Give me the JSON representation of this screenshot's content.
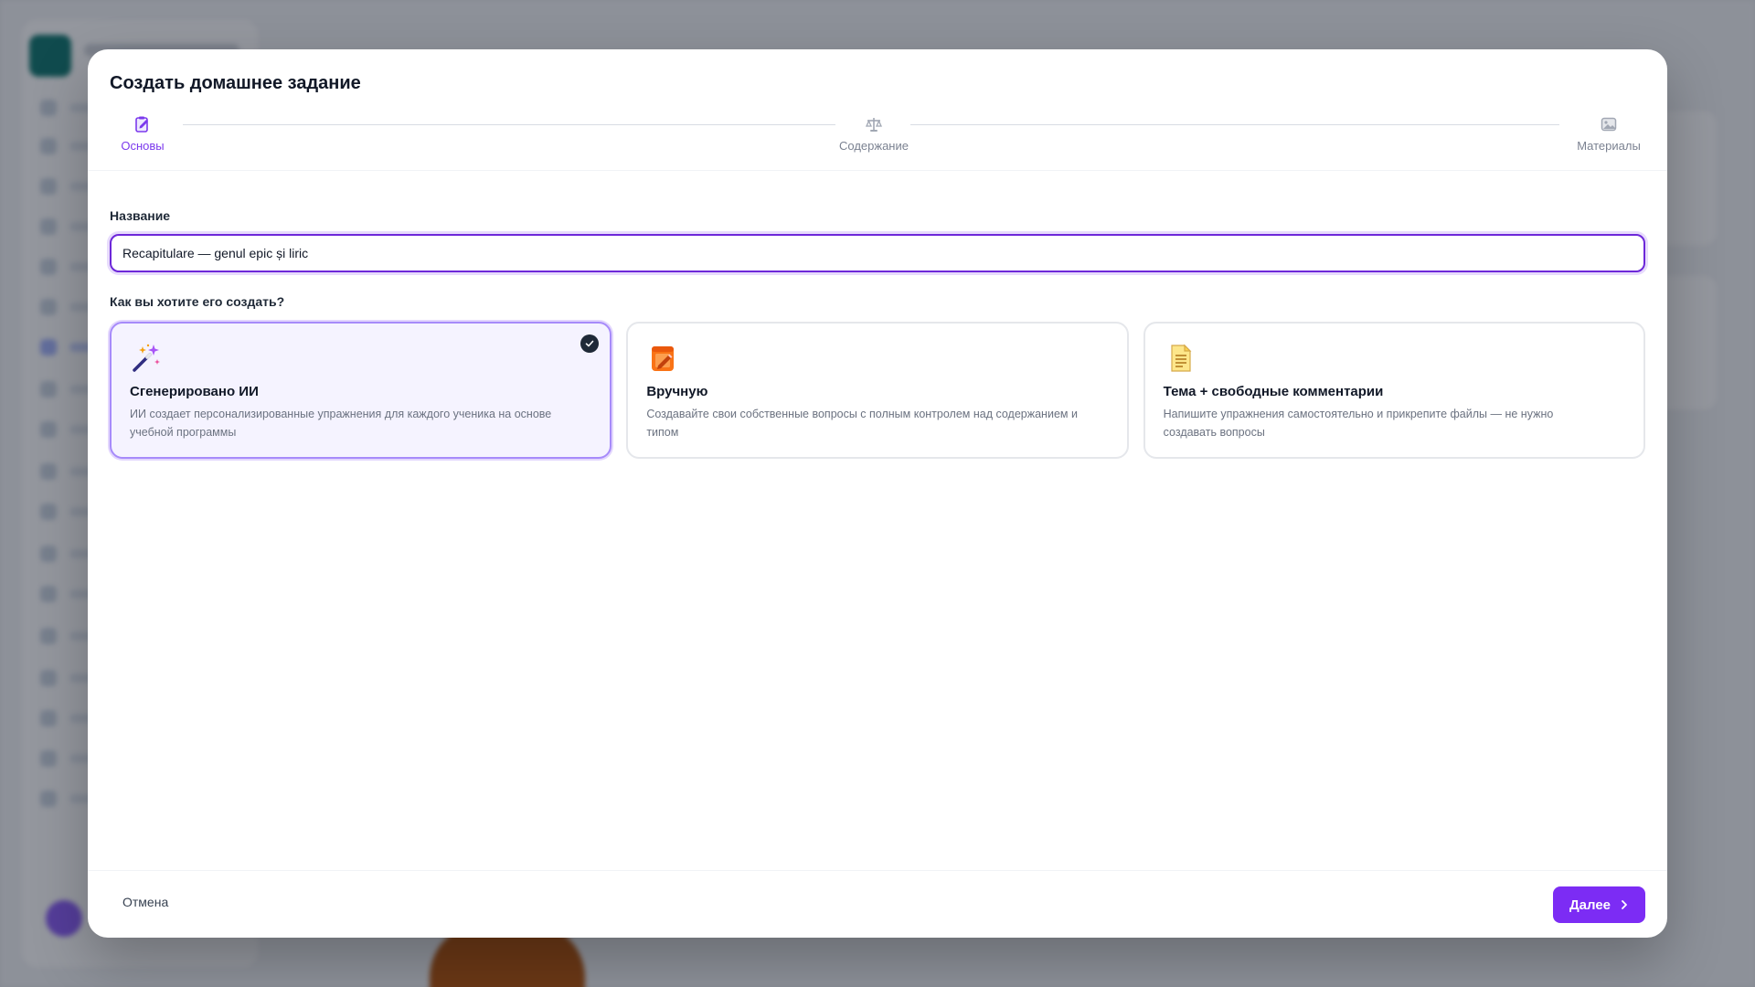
{
  "modal": {
    "title": "Создать домашнее задание"
  },
  "steps": [
    {
      "label": "Основы",
      "icon": "clipboard-edit-icon",
      "state": "active"
    },
    {
      "label": "Содержание",
      "icon": "scales-icon",
      "state": "inactive"
    },
    {
      "label": "Материалы",
      "icon": "images-icon",
      "state": "inactive"
    }
  ],
  "name_field": {
    "label": "Название",
    "value": "Recapitulare — genul epic și liric"
  },
  "creation_method": {
    "label": "Как вы хотите его создать?",
    "options": [
      {
        "title": "Сгенерировано ИИ",
        "description": "ИИ создает персонализированные упражнения для каждого ученика на основе учебной программы",
        "icon": "magic-wand-icon",
        "selected": true
      },
      {
        "title": "Вручную",
        "description": "Создавайте свои собственные вопросы с полным контролем над содержанием и типом",
        "icon": "notebook-pencil-icon",
        "selected": false
      },
      {
        "title": "Тема + свободные комментарии",
        "description": "Напишите упражнения самостоятельно и прикрепите файлы — не нужно создавать вопросы",
        "icon": "document-icon",
        "selected": false
      }
    ]
  },
  "footer": {
    "cancel_label": "Отмена",
    "next_label": "Далее"
  },
  "colors": {
    "accent": "#7c2cf4",
    "active_step": "#7c3aed",
    "selected_border": "#a78bfa",
    "selected_bg": "#f5f3ff"
  }
}
